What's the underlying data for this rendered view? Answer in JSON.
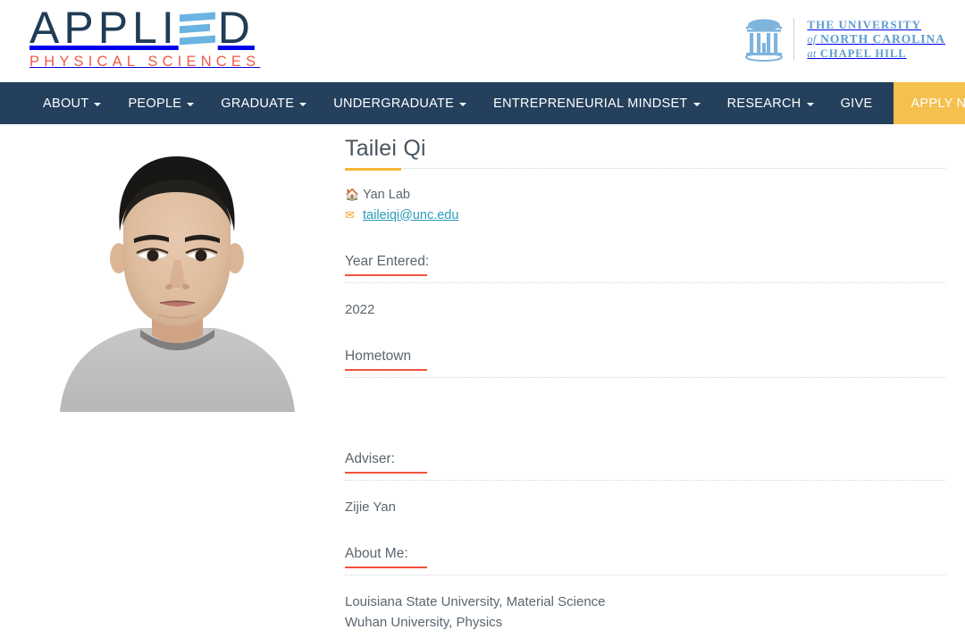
{
  "header": {
    "logo": {
      "wordmark_part1": "APPLI",
      "wordmark_e_icon": "stacked-bars-e-icon",
      "wordmark_part2": "D",
      "subtitle": "PHYSICAL SCIENCES",
      "navy_color": "#203c56",
      "bar_color": "#6bb3e0",
      "subtitle_color": "#f05a47"
    },
    "university": {
      "seal_icon": "old-well-icon",
      "line1": "THE UNIVERSITY",
      "line2_italic": "of",
      "line2": "NORTH CAROLINA",
      "line3_italic": "at",
      "line3": "CHAPEL HILL",
      "color": "#5b9bd1"
    }
  },
  "nav": {
    "background": "#24405c",
    "apply_background": "#f5c04e",
    "items": [
      {
        "label": "ABOUT",
        "has_dropdown": true
      },
      {
        "label": "PEOPLE",
        "has_dropdown": true
      },
      {
        "label": "GRADUATE",
        "has_dropdown": true
      },
      {
        "label": "UNDERGRADUATE",
        "has_dropdown": true
      },
      {
        "label": "ENTREPRENEURIAL MINDSET",
        "has_dropdown": true
      },
      {
        "label": "RESEARCH",
        "has_dropdown": true
      },
      {
        "label": "GIVE",
        "has_dropdown": false
      }
    ],
    "apply": {
      "label": "APPLY NOW"
    }
  },
  "profile": {
    "photo_alt": "portrait-photo",
    "name": "Tailei Qi",
    "title_rule_color": "#f7b733",
    "lab": {
      "icon": "home-icon",
      "label": "Yan Lab"
    },
    "email": {
      "icon": "envelope-icon",
      "label": "taileiqi@unc.edu",
      "color": "#2b9cb8"
    },
    "sections": [
      {
        "heading": "Year Entered:",
        "body": [
          "2022"
        ]
      },
      {
        "heading": "Hometown",
        "body": []
      },
      {
        "heading": "Adviser:",
        "body": [
          "Zijie Yan"
        ]
      },
      {
        "heading": "About Me:",
        "body": [
          "Louisiana State University, Material Science",
          "Wuhan University, Physics"
        ]
      }
    ],
    "heading_underline_color": "#f0533c"
  }
}
